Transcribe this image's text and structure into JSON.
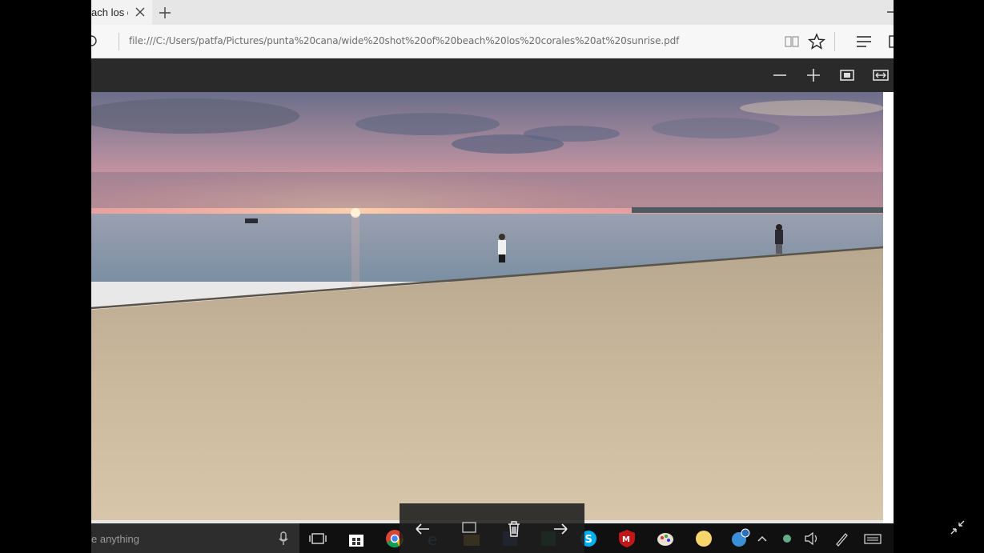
{
  "browser": {
    "tab_title": "ach los c",
    "url": "file:///C:/Users/patfa/Pictures/punta%20cana/wide%20shot%20of%20beach%20los%20corales%20at%20sunrise.pdf"
  },
  "icons": {
    "tab_close": "close-icon",
    "new_tab": "plus-icon",
    "refresh": "refresh-icon",
    "reading_view": "book-icon",
    "favorite": "star-icon",
    "hub": "hub-icon",
    "zoom_out": "minus-icon",
    "zoom_in": "plus-icon",
    "fit_page": "fit-page-icon",
    "fit_width": "fit-width-icon"
  },
  "taskbar": {
    "search_placeholder": "e anything",
    "apps": [
      "task-view-icon",
      "store-icon",
      "chrome-icon",
      "edge-icon",
      "file-explorer-icon",
      "word-icon",
      "excel-icon",
      "skype-icon",
      "mcafee-icon",
      "paint-icon",
      "sticky-notes-icon",
      "photos-icon"
    ],
    "tray": [
      "chevron-up-icon",
      "network-icon",
      "volume-icon",
      "pen-icon",
      "keyboard-icon"
    ]
  },
  "photo_nav": {
    "buttons": [
      "back-arrow-icon",
      "slideshow-icon",
      "delete-icon",
      "forward-arrow-icon"
    ]
  },
  "colors": {
    "pdf_toolbar": "#2a2a2a",
    "taskbar": "#101010",
    "sky_top": "#6b6e8a",
    "sunset": "#e89a9a",
    "sand": "#c9b89a",
    "sea": "#8a98a8"
  }
}
